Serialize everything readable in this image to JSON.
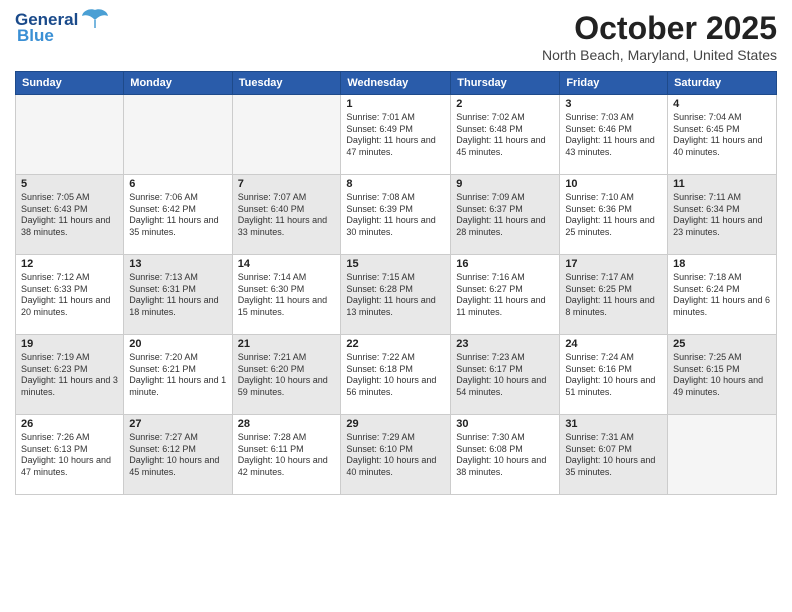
{
  "header": {
    "logo_general": "General",
    "logo_blue": "Blue",
    "month_title": "October 2025",
    "location": "North Beach, Maryland, United States"
  },
  "weekdays": [
    "Sunday",
    "Monday",
    "Tuesday",
    "Wednesday",
    "Thursday",
    "Friday",
    "Saturday"
  ],
  "weeks": [
    [
      {
        "day": "",
        "info": "",
        "empty": true
      },
      {
        "day": "",
        "info": "",
        "empty": true
      },
      {
        "day": "",
        "info": "",
        "empty": true
      },
      {
        "day": "1",
        "info": "Sunrise: 7:01 AM\nSunset: 6:49 PM\nDaylight: 11 hours\nand 47 minutes."
      },
      {
        "day": "2",
        "info": "Sunrise: 7:02 AM\nSunset: 6:48 PM\nDaylight: 11 hours\nand 45 minutes."
      },
      {
        "day": "3",
        "info": "Sunrise: 7:03 AM\nSunset: 6:46 PM\nDaylight: 11 hours\nand 43 minutes."
      },
      {
        "day": "4",
        "info": "Sunrise: 7:04 AM\nSunset: 6:45 PM\nDaylight: 11 hours\nand 40 minutes."
      }
    ],
    [
      {
        "day": "5",
        "info": "Sunrise: 7:05 AM\nSunset: 6:43 PM\nDaylight: 11 hours\nand 38 minutes.",
        "shaded": true
      },
      {
        "day": "6",
        "info": "Sunrise: 7:06 AM\nSunset: 6:42 PM\nDaylight: 11 hours\nand 35 minutes."
      },
      {
        "day": "7",
        "info": "Sunrise: 7:07 AM\nSunset: 6:40 PM\nDaylight: 11 hours\nand 33 minutes.",
        "shaded": true
      },
      {
        "day": "8",
        "info": "Sunrise: 7:08 AM\nSunset: 6:39 PM\nDaylight: 11 hours\nand 30 minutes."
      },
      {
        "day": "9",
        "info": "Sunrise: 7:09 AM\nSunset: 6:37 PM\nDaylight: 11 hours\nand 28 minutes.",
        "shaded": true
      },
      {
        "day": "10",
        "info": "Sunrise: 7:10 AM\nSunset: 6:36 PM\nDaylight: 11 hours\nand 25 minutes."
      },
      {
        "day": "11",
        "info": "Sunrise: 7:11 AM\nSunset: 6:34 PM\nDaylight: 11 hours\nand 23 minutes.",
        "shaded": true
      }
    ],
    [
      {
        "day": "12",
        "info": "Sunrise: 7:12 AM\nSunset: 6:33 PM\nDaylight: 11 hours\nand 20 minutes."
      },
      {
        "day": "13",
        "info": "Sunrise: 7:13 AM\nSunset: 6:31 PM\nDaylight: 11 hours\nand 18 minutes.",
        "shaded": true
      },
      {
        "day": "14",
        "info": "Sunrise: 7:14 AM\nSunset: 6:30 PM\nDaylight: 11 hours\nand 15 minutes."
      },
      {
        "day": "15",
        "info": "Sunrise: 7:15 AM\nSunset: 6:28 PM\nDaylight: 11 hours\nand 13 minutes.",
        "shaded": true
      },
      {
        "day": "16",
        "info": "Sunrise: 7:16 AM\nSunset: 6:27 PM\nDaylight: 11 hours\nand 11 minutes."
      },
      {
        "day": "17",
        "info": "Sunrise: 7:17 AM\nSunset: 6:25 PM\nDaylight: 11 hours\nand 8 minutes.",
        "shaded": true
      },
      {
        "day": "18",
        "info": "Sunrise: 7:18 AM\nSunset: 6:24 PM\nDaylight: 11 hours\nand 6 minutes."
      }
    ],
    [
      {
        "day": "19",
        "info": "Sunrise: 7:19 AM\nSunset: 6:23 PM\nDaylight: 11 hours\nand 3 minutes.",
        "shaded": true
      },
      {
        "day": "20",
        "info": "Sunrise: 7:20 AM\nSunset: 6:21 PM\nDaylight: 11 hours\nand 1 minute."
      },
      {
        "day": "21",
        "info": "Sunrise: 7:21 AM\nSunset: 6:20 PM\nDaylight: 10 hours\nand 59 minutes.",
        "shaded": true
      },
      {
        "day": "22",
        "info": "Sunrise: 7:22 AM\nSunset: 6:18 PM\nDaylight: 10 hours\nand 56 minutes."
      },
      {
        "day": "23",
        "info": "Sunrise: 7:23 AM\nSunset: 6:17 PM\nDaylight: 10 hours\nand 54 minutes.",
        "shaded": true
      },
      {
        "day": "24",
        "info": "Sunrise: 7:24 AM\nSunset: 6:16 PM\nDaylight: 10 hours\nand 51 minutes."
      },
      {
        "day": "25",
        "info": "Sunrise: 7:25 AM\nSunset: 6:15 PM\nDaylight: 10 hours\nand 49 minutes.",
        "shaded": true
      }
    ],
    [
      {
        "day": "26",
        "info": "Sunrise: 7:26 AM\nSunset: 6:13 PM\nDaylight: 10 hours\nand 47 minutes."
      },
      {
        "day": "27",
        "info": "Sunrise: 7:27 AM\nSunset: 6:12 PM\nDaylight: 10 hours\nand 45 minutes.",
        "shaded": true
      },
      {
        "day": "28",
        "info": "Sunrise: 7:28 AM\nSunset: 6:11 PM\nDaylight: 10 hours\nand 42 minutes."
      },
      {
        "day": "29",
        "info": "Sunrise: 7:29 AM\nSunset: 6:10 PM\nDaylight: 10 hours\nand 40 minutes.",
        "shaded": true
      },
      {
        "day": "30",
        "info": "Sunrise: 7:30 AM\nSunset: 6:08 PM\nDaylight: 10 hours\nand 38 minutes."
      },
      {
        "day": "31",
        "info": "Sunrise: 7:31 AM\nSunset: 6:07 PM\nDaylight: 10 hours\nand 35 minutes.",
        "shaded": true
      },
      {
        "day": "",
        "info": "",
        "empty": true
      }
    ]
  ]
}
